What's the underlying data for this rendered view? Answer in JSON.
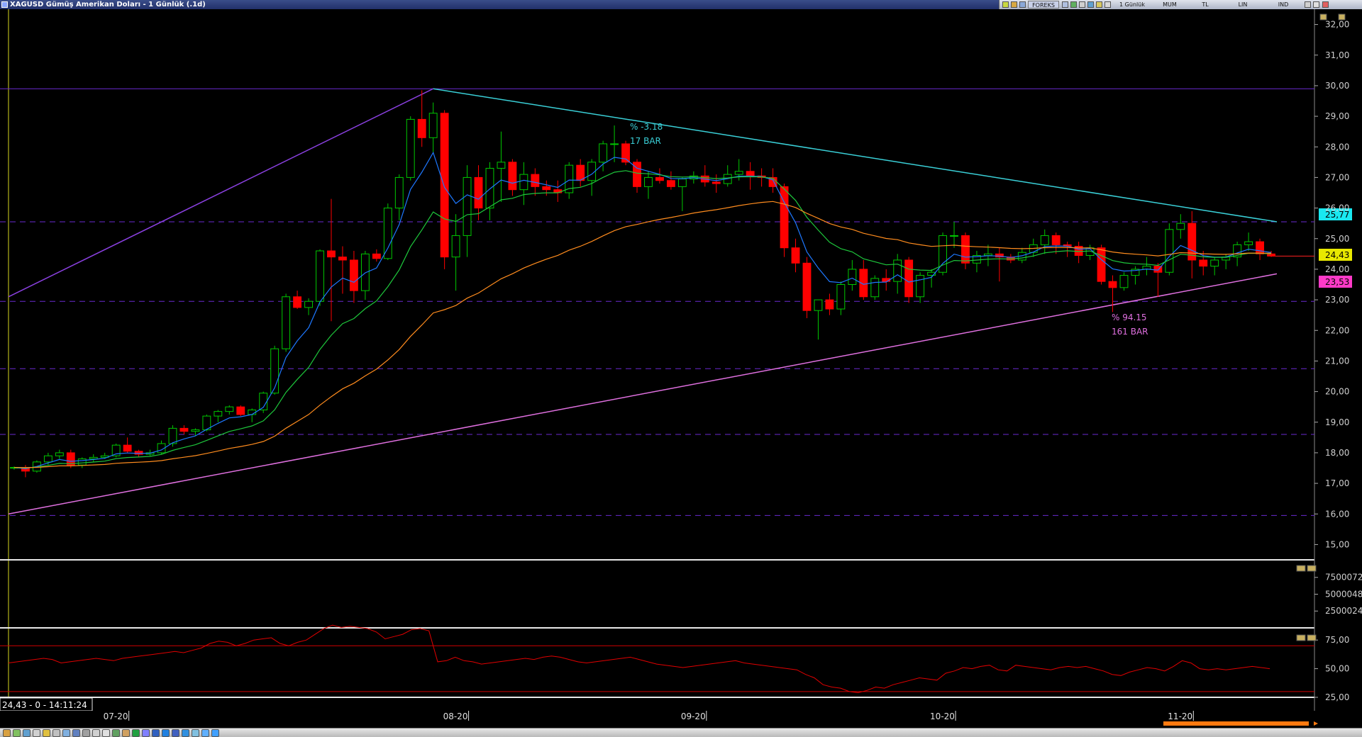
{
  "window": {
    "title": "XAGUSD Gümüş Amerikan Doları - 1 Günlük (.1d)"
  },
  "toolbar": {
    "forex_label": "FOREKS",
    "period_label": "1 Günlük",
    "chart_type_label": "MUM",
    "currency_label": "TL",
    "scale_label": "LIN",
    "indicator_label": "IND"
  },
  "price_axis": {
    "labels": [
      "32,00",
      "31,00",
      "30,00",
      "29,00",
      "28,00",
      "27,00",
      "26,00",
      "25,00",
      "24,00",
      "23,00",
      "22,00",
      "21,00",
      "20,00",
      "19,00",
      "18,00",
      "17,00",
      "16,00",
      "15,00"
    ],
    "badge_resistance": "25,77",
    "badge_last": "24,43",
    "badge_support": "23,53"
  },
  "volume_axis": {
    "labels": [
      "7500072",
      "5000048",
      "2500024"
    ]
  },
  "rsi_axis": {
    "labels": [
      "75,00",
      "50,00",
      "25,00"
    ]
  },
  "annotations": {
    "upper_pct": "% -3.18",
    "upper_bars": "17 BAR",
    "lower_pct": "% 94.15",
    "lower_bars": "161 BAR"
  },
  "time_axis": {
    "cursor_readout": "24,43 - 0 - 14:11:24",
    "labels": [
      "07-20",
      "08-20",
      "09-20",
      "10-20",
      "11-20"
    ]
  },
  "colors": {
    "up_candle": "#00c800",
    "down_candle": "#ff0000",
    "ma_fast": "#1e78ff",
    "ma_mid": "#1ec83c",
    "ma_slow": "#ff8c1e",
    "upper_trend": "#3ad0d8",
    "lower_trend": "#e070e0",
    "hline": "#6a2ad0",
    "rsi": "#e00000",
    "panel_border": "#e8e8e8",
    "badge_cyan": "#19e8f0",
    "badge_yellow": "#e8e800",
    "badge_pink": "#ff3ac8"
  },
  "chart_data": {
    "type": "candlestick",
    "symbol": "XAGUSD",
    "period": "1d",
    "ylim": [
      14.5,
      32.5
    ],
    "x_labels": [
      "07-20",
      "08-20",
      "09-20",
      "10-20",
      "11-20"
    ],
    "x_label_index": [
      9,
      39,
      60,
      82,
      103
    ],
    "horizontal_levels": [
      29.9,
      25.55,
      22.95,
      20.75,
      18.6,
      15.95
    ],
    "upper_trendline": [
      [
        37,
        29.9
      ],
      [
        111.5,
        25.55
      ]
    ],
    "lower_trendline": [
      [
        -0.5,
        16.0
      ],
      [
        111.5,
        23.85
      ]
    ],
    "left_trendline": [
      [
        -0.5,
        23.1
      ],
      [
        37,
        29.9
      ]
    ],
    "candles": [
      [
        17.5,
        17.55,
        17.45,
        17.52
      ],
      [
        17.52,
        17.6,
        17.2,
        17.4
      ],
      [
        17.4,
        17.75,
        17.35,
        17.7
      ],
      [
        17.7,
        18.0,
        17.6,
        17.9
      ],
      [
        17.9,
        18.1,
        17.8,
        18.0
      ],
      [
        18.0,
        18.1,
        17.5,
        17.6
      ],
      [
        17.6,
        17.85,
        17.5,
        17.8
      ],
      [
        17.8,
        17.95,
        17.7,
        17.85
      ],
      [
        17.85,
        18.0,
        17.8,
        17.9
      ],
      [
        17.9,
        18.3,
        17.85,
        18.25
      ],
      [
        18.25,
        18.5,
        18.0,
        18.05
      ],
      [
        18.05,
        18.1,
        17.85,
        17.95
      ],
      [
        17.95,
        18.1,
        17.9,
        18.0
      ],
      [
        18.0,
        18.4,
        17.95,
        18.3
      ],
      [
        18.3,
        18.9,
        18.2,
        18.8
      ],
      [
        18.8,
        18.9,
        18.6,
        18.7
      ],
      [
        18.7,
        18.8,
        18.55,
        18.75
      ],
      [
        18.75,
        19.25,
        18.7,
        19.2
      ],
      [
        19.2,
        19.4,
        19.0,
        19.35
      ],
      [
        19.35,
        19.55,
        19.25,
        19.5
      ],
      [
        19.5,
        19.55,
        19.2,
        19.25
      ],
      [
        19.25,
        19.45,
        19.0,
        19.4
      ],
      [
        19.4,
        20.0,
        19.3,
        19.95
      ],
      [
        19.95,
        21.5,
        19.9,
        21.4
      ],
      [
        21.4,
        23.2,
        21.3,
        23.1
      ],
      [
        23.1,
        23.3,
        22.7,
        22.75
      ],
      [
        22.75,
        23.05,
        22.5,
        22.95
      ],
      [
        22.95,
        24.65,
        22.8,
        24.6
      ],
      [
        24.6,
        26.3,
        22.3,
        24.4
      ],
      [
        24.4,
        24.75,
        23.2,
        24.3
      ],
      [
        24.3,
        24.6,
        22.9,
        23.3
      ],
      [
        23.3,
        24.6,
        23.0,
        24.5
      ],
      [
        24.5,
        24.65,
        24.25,
        24.35
      ],
      [
        24.35,
        26.15,
        24.3,
        26.0
      ],
      [
        26.0,
        27.1,
        25.6,
        27.0
      ],
      [
        27.0,
        29.0,
        26.9,
        28.9
      ],
      [
        28.9,
        29.85,
        28.0,
        28.3
      ],
      [
        28.3,
        29.45,
        27.8,
        29.1
      ],
      [
        29.1,
        29.2,
        24.0,
        24.4
      ],
      [
        24.4,
        25.8,
        23.3,
        25.1
      ],
      [
        25.1,
        27.4,
        24.4,
        27.0
      ],
      [
        27.0,
        27.4,
        25.6,
        26.0
      ],
      [
        26.0,
        27.5,
        25.6,
        27.3
      ],
      [
        27.3,
        28.5,
        26.2,
        27.5
      ],
      [
        27.5,
        27.6,
        26.4,
        26.6
      ],
      [
        26.6,
        27.5,
        26.1,
        27.1
      ],
      [
        27.1,
        27.3,
        26.4,
        26.7
      ],
      [
        26.7,
        26.9,
        26.4,
        26.6
      ],
      [
        26.6,
        26.9,
        26.2,
        26.5
      ],
      [
        26.5,
        27.5,
        26.3,
        27.4
      ],
      [
        27.4,
        27.6,
        26.7,
        26.9
      ],
      [
        26.9,
        27.6,
        26.4,
        27.5
      ],
      [
        27.5,
        28.2,
        27.2,
        28.1
      ],
      [
        28.1,
        28.7,
        27.5,
        28.1
      ],
      [
        28.1,
        28.2,
        27.4,
        27.5
      ],
      [
        27.5,
        27.6,
        26.5,
        26.7
      ],
      [
        26.7,
        27.2,
        26.3,
        27.0
      ],
      [
        27.0,
        27.3,
        26.8,
        26.9
      ],
      [
        26.9,
        27.2,
        26.6,
        26.7
      ],
      [
        26.7,
        27.0,
        25.9,
        26.95
      ],
      [
        26.95,
        27.2,
        26.8,
        27.05
      ],
      [
        27.05,
        27.4,
        26.7,
        26.85
      ],
      [
        26.85,
        27.1,
        26.5,
        26.8
      ],
      [
        26.8,
        27.4,
        26.7,
        27.1
      ],
      [
        27.1,
        27.6,
        26.9,
        27.2
      ],
      [
        27.2,
        27.5,
        26.6,
        27.05
      ],
      [
        27.05,
        27.3,
        26.7,
        27.0
      ],
      [
        27.0,
        27.3,
        26.5,
        26.7
      ],
      [
        26.7,
        26.8,
        24.4,
        24.7
      ],
      [
        24.7,
        25.0,
        23.9,
        24.2
      ],
      [
        24.2,
        24.4,
        22.4,
        22.65
      ],
      [
        22.65,
        23.0,
        21.7,
        23.0
      ],
      [
        23.0,
        23.2,
        22.5,
        22.7
      ],
      [
        22.7,
        23.6,
        22.5,
        23.5
      ],
      [
        23.5,
        24.3,
        23.3,
        24.0
      ],
      [
        24.0,
        24.3,
        23.0,
        23.1
      ],
      [
        23.1,
        23.8,
        23.0,
        23.7
      ],
      [
        23.7,
        24.0,
        23.3,
        23.6
      ],
      [
        23.6,
        24.5,
        23.2,
        24.3
      ],
      [
        24.3,
        24.4,
        22.9,
        23.1
      ],
      [
        23.1,
        23.9,
        22.9,
        23.8
      ],
      [
        23.8,
        24.0,
        23.4,
        23.9
      ],
      [
        23.9,
        25.2,
        23.8,
        25.1
      ],
      [
        25.1,
        25.55,
        24.7,
        25.1
      ],
      [
        25.1,
        25.2,
        24.0,
        24.2
      ],
      [
        24.2,
        24.6,
        23.9,
        24.45
      ],
      [
        24.45,
        24.8,
        24.1,
        24.5
      ],
      [
        24.5,
        24.7,
        23.6,
        24.4
      ],
      [
        24.4,
        24.5,
        24.2,
        24.3
      ],
      [
        24.3,
        24.7,
        24.2,
        24.55
      ],
      [
        24.55,
        25.0,
        24.4,
        24.8
      ],
      [
        24.8,
        25.3,
        24.5,
        25.1
      ],
      [
        25.1,
        25.2,
        24.5,
        24.8
      ],
      [
        24.8,
        24.9,
        24.4,
        24.75
      ],
      [
        24.75,
        24.9,
        24.2,
        24.45
      ],
      [
        24.45,
        24.8,
        24.3,
        24.7
      ],
      [
        24.7,
        24.8,
        23.5,
        23.6
      ],
      [
        23.6,
        23.8,
        22.6,
        23.4
      ],
      [
        23.4,
        23.9,
        23.3,
        23.8
      ],
      [
        23.8,
        24.1,
        23.5,
        24.0
      ],
      [
        24.0,
        24.4,
        23.8,
        24.1
      ],
      [
        24.1,
        24.2,
        23.1,
        23.9
      ],
      [
        23.9,
        25.5,
        23.8,
        25.3
      ],
      [
        25.3,
        25.8,
        25.0,
        25.5
      ],
      [
        25.5,
        25.9,
        23.7,
        24.3
      ],
      [
        24.3,
        24.6,
        23.8,
        24.1
      ],
      [
        24.1,
        24.4,
        23.8,
        24.3
      ],
      [
        24.3,
        24.5,
        24.0,
        24.4
      ],
      [
        24.4,
        24.9,
        24.1,
        24.8
      ],
      [
        24.8,
        25.2,
        24.6,
        24.9
      ],
      [
        24.9,
        25.0,
        24.3,
        24.5
      ],
      [
        24.5,
        24.6,
        24.4,
        24.43
      ]
    ],
    "rsi": [
      55,
      56,
      57,
      58,
      59,
      58,
      55,
      56,
      57,
      58,
      59,
      58,
      57,
      59,
      60,
      61,
      62,
      63,
      64,
      65,
      64,
      66,
      68,
      72,
      74,
      73,
      70,
      72,
      75,
      76,
      77,
      72,
      70,
      73,
      75,
      80,
      85,
      88,
      86,
      87,
      86,
      85,
      82,
      76,
      78,
      80,
      84,
      85,
      83,
      56,
      57,
      60,
      57,
      56,
      54,
      55,
      56,
      57,
      58,
      59,
      58,
      60,
      61,
      60,
      58,
      56,
      55,
      56,
      57,
      58,
      59,
      60,
      58,
      56,
      54,
      53,
      52,
      51,
      52,
      53,
      54,
      55,
      56,
      57,
      55,
      54,
      53,
      52,
      51,
      50,
      49,
      45,
      42,
      36,
      34,
      33,
      30,
      29,
      31,
      34,
      33,
      36,
      38,
      40,
      42,
      41,
      40,
      46,
      48,
      51,
      50,
      52,
      53,
      49,
      48,
      53,
      52,
      51,
      50,
      49,
      51,
      52,
      51,
      52,
      50,
      48,
      45,
      44,
      47,
      49,
      51,
      50,
      48,
      52,
      57,
      55,
      50,
      49,
      50,
      49,
      50,
      51,
      52,
      51,
      50
    ]
  },
  "volume_panel": {
    "ylim": [
      0,
      10000000
    ]
  },
  "rsi_panel": {
    "levels": [
      70,
      30
    ],
    "ylim": [
      25,
      85
    ]
  }
}
